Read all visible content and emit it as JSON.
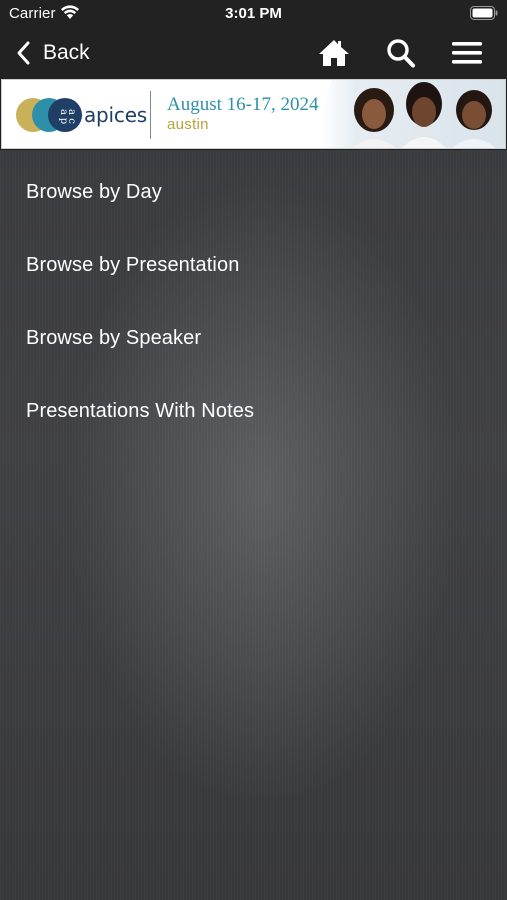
{
  "status_bar": {
    "carrier": "Carrier",
    "time": "3:01 PM"
  },
  "nav": {
    "back_label": "Back",
    "icons": [
      "home-icon",
      "search-icon",
      "menu-icon"
    ]
  },
  "banner": {
    "brand": "apices",
    "logo_letters": "apac",
    "date": "August 16-17, 2024",
    "city": "austin",
    "colors": {
      "gold": "#c9b15a",
      "teal": "#2e8fa8",
      "navy": "#1f3f66"
    }
  },
  "menu": {
    "items": [
      {
        "label": "Browse by Day"
      },
      {
        "label": "Browse by Presentation"
      },
      {
        "label": "Browse by Speaker"
      },
      {
        "label": "Presentations With Notes"
      }
    ]
  }
}
